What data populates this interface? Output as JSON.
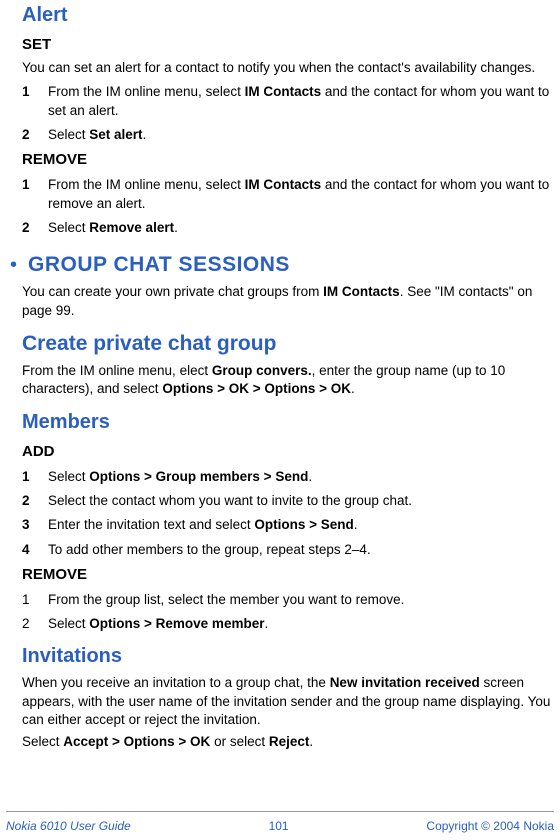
{
  "alert": {
    "heading": "Alert",
    "set": {
      "heading": "SET",
      "intro": "You can set an alert for a contact to notify you when the contact's availability changes.",
      "step1_num": "1",
      "step1_pre": "From the IM online menu, select ",
      "step1_bold": "IM Contacts",
      "step1_post": " and the contact for whom you want to set an alert.",
      "step2_num": "2",
      "step2_pre": "Select ",
      "step2_bold": "Set alert",
      "step2_post": "."
    },
    "remove": {
      "heading": "REMOVE",
      "step1_num": "1",
      "step1_pre": "From the IM online menu, select ",
      "step1_bold": "IM Contacts",
      "step1_post": " and the contact for whom you want to remove an alert.",
      "step2_num": "2",
      "step2_pre": "Select ",
      "step2_bold": "Remove alert",
      "step2_post": "."
    }
  },
  "group": {
    "bullet": "•",
    "heading": "GROUP CHAT SESSIONS",
    "intro_pre": "You can create your own private chat groups from ",
    "intro_bold": "IM Contacts",
    "intro_post": ". See \"IM contacts\" on page 99.",
    "create": {
      "heading": "Create private chat group",
      "pre": "From the IM online menu, elect ",
      "bold1": "Group convers.",
      "mid": ", enter the group name (up to 10 characters), and select ",
      "bold2": "Options > OK > Options > OK",
      "post": "."
    },
    "members": {
      "heading": "Members",
      "add": {
        "heading": "ADD",
        "s1_num": "1",
        "s1_pre": "Select ",
        "s1_bold": "Options > Group members > Send",
        "s1_post": ".",
        "s2_num": "2",
        "s2_text": "Select the contact whom you want to invite to the group chat.",
        "s3_num": "3",
        "s3_pre": "Enter the invitation text and select ",
        "s3_bold": "Options > Send",
        "s3_post": ".",
        "s4_num": "4",
        "s4_text": "To add other members to the group, repeat steps 2–4."
      },
      "remove": {
        "heading": "REMOVE",
        "s1_num": "1",
        "s1_text": "From the group list, select the member you want to remove.",
        "s2_num": "2",
        "s2_pre": "Select ",
        "s2_bold": "Options > Remove member",
        "s2_post": "."
      }
    },
    "invitations": {
      "heading": "Invitations",
      "p1_pre": "When you receive an invitation to a group chat, the ",
      "p1_bold": "New invitation received",
      "p1_post": " screen appears, with the user name of the invitation sender and the group name displaying. You can either accept or reject the invitation.",
      "p2_pre": "Select ",
      "p2_bold1": "Accept > Options > OK",
      "p2_mid": " or select ",
      "p2_bold2": "Reject",
      "p2_post": "."
    }
  },
  "footer": {
    "left": "Nokia 6010 User Guide",
    "center": "101",
    "right": "Copyright © 2004 Nokia"
  }
}
